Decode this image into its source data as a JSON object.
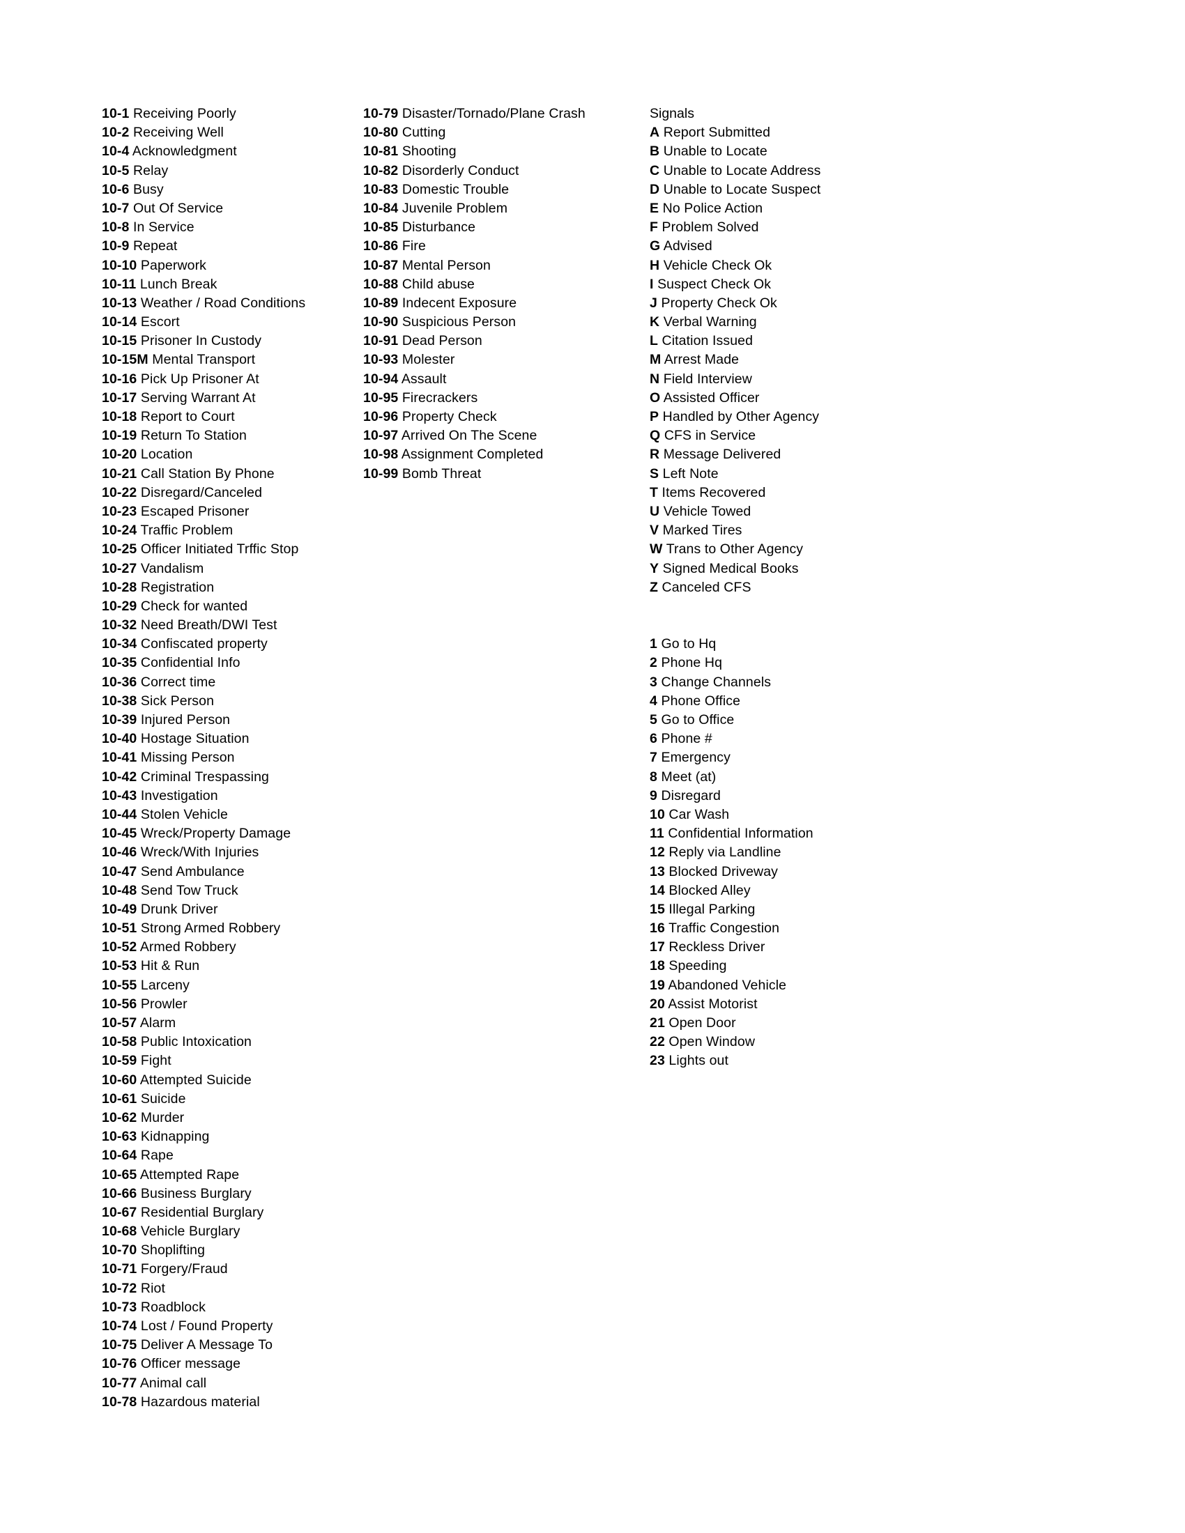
{
  "document": {
    "type": "police-ten-code-reference-sheet",
    "columns": {
      "codes_left": {
        "entries": [
          {
            "code": "10-1",
            "label": "Receiving Poorly"
          },
          {
            "code": "10-2",
            "label": "Receiving Well"
          },
          {
            "code": "10-4",
            "label": "Acknowledgment"
          },
          {
            "code": "10-5",
            "label": "Relay"
          },
          {
            "code": "10-6",
            "label": "Busy"
          },
          {
            "code": "10-7",
            "label": "Out Of Service"
          },
          {
            "code": "10-8",
            "label": "In Service"
          },
          {
            "code": "10-9",
            "label": "Repeat"
          },
          {
            "code": "10-10",
            "label": "Paperwork"
          },
          {
            "code": "10-11",
            "label": "Lunch Break"
          },
          {
            "code": "10-13",
            "label": "Weather / Road Conditions"
          },
          {
            "code": "10-14",
            "label": "Escort"
          },
          {
            "code": "10-15",
            "label": "Prisoner In Custody"
          },
          {
            "code": "10-15M",
            "label": " Mental Transport"
          },
          {
            "code": "10-16",
            "label": "Pick Up Prisoner At"
          },
          {
            "code": "10-17",
            "label": "Serving Warrant At"
          },
          {
            "code": "10-18",
            "label": "Report to Court"
          },
          {
            "code": "10-19",
            "label": "Return To Station"
          },
          {
            "code": "10-20",
            "label": "Location"
          },
          {
            "code": "10-21",
            "label": "Call Station By Phone"
          },
          {
            "code": "10-22",
            "label": "Disregard/Canceled"
          },
          {
            "code": "10-23",
            "label": "Escaped Prisoner"
          },
          {
            "code": "10-24",
            "label": "Traffic Problem"
          },
          {
            "code": "10-25",
            "label": "Officer Initiated Trffic Stop"
          },
          {
            "code": "10-27",
            "label": "Vandalism"
          },
          {
            "code": "10-28",
            "label": "Registration"
          },
          {
            "code": "10-29",
            "label": "Check for wanted"
          },
          {
            "code": "10-32",
            "label": "Need Breath/DWI Test"
          },
          {
            "code": "10-34",
            "label": "Confiscated property"
          },
          {
            "code": "10-35",
            "label": "Confidential Info"
          },
          {
            "code": "10-36",
            "label": "Correct time"
          },
          {
            "code": "10-38",
            "label": "Sick Person"
          },
          {
            "code": "10-39",
            "label": "Injured Person"
          },
          {
            "code": "10-40",
            "label": "Hostage Situation"
          },
          {
            "code": "10-41",
            "label": "Missing Person"
          },
          {
            "code": "10-42",
            "label": "Criminal Trespassing"
          },
          {
            "code": "10-43",
            "label": "Investigation"
          },
          {
            "code": "10-44",
            "label": "Stolen Vehicle"
          },
          {
            "code": "10-45",
            "label": "Wreck/Property Damage"
          },
          {
            "code": "10-46",
            "label": "Wreck/With Injuries"
          },
          {
            "code": "10-47",
            "label": "Send Ambulance"
          },
          {
            "code": "10-48",
            "label": "Send Tow Truck"
          },
          {
            "code": "10-49",
            "label": "Drunk Driver"
          },
          {
            "code": "10-51",
            "label": "Strong Armed Robbery"
          },
          {
            "code": "10-52",
            "label": "Armed Robbery"
          },
          {
            "code": "10-53",
            "label": "Hit & Run"
          },
          {
            "code": "10-55",
            "label": "Larceny"
          },
          {
            "code": "10-56",
            "label": "Prowler"
          },
          {
            "code": "10-57",
            "label": "Alarm"
          },
          {
            "code": "10-58",
            "label": "Public Intoxication"
          },
          {
            "code": "10-59",
            "label": "Fight"
          },
          {
            "code": "10-60",
            "label": "Attempted Suicide"
          },
          {
            "code": "10-61",
            "label": "Suicide"
          },
          {
            "code": "10-62",
            "label": "Murder"
          },
          {
            "code": "10-63",
            "label": "Kidnapping"
          },
          {
            "code": "10-64",
            "label": "Rape"
          },
          {
            "code": "10-65",
            "label": "Attempted Rape"
          },
          {
            "code": "10-66",
            "label": "Business Burglary"
          },
          {
            "code": "10-67",
            "label": "Residential Burglary"
          },
          {
            "code": "10-68",
            "label": "Vehicle Burglary"
          },
          {
            "code": "10-70",
            "label": "Shoplifting"
          },
          {
            "code": "10-71",
            "label": "Forgery/Fraud"
          },
          {
            "code": "10-72",
            "label": "Riot"
          },
          {
            "code": "10-73",
            "label": "Roadblock"
          },
          {
            "code": "10-74",
            "label": "Lost / Found Property"
          },
          {
            "code": "10-75",
            "label": "Deliver A Message To"
          },
          {
            "code": "10-76",
            "label": "Officer message"
          },
          {
            "code": "10-77",
            "label": "Animal call"
          },
          {
            "code": "10-78",
            "label": "Hazardous material"
          }
        ]
      },
      "codes_middle": {
        "entries": [
          {
            "code": "10-79",
            "label": "Disaster/Tornado/Plane Crash"
          },
          {
            "code": "10-80",
            "label": "Cutting"
          },
          {
            "code": "10-81",
            "label": "Shooting"
          },
          {
            "code": "10-82",
            "label": "Disorderly Conduct"
          },
          {
            "code": "10-83",
            "label": "Domestic Trouble"
          },
          {
            "code": "10-84",
            "label": "Juvenile Problem"
          },
          {
            "code": "10-85",
            "label": "Disturbance"
          },
          {
            "code": "10-86",
            "label": "Fire"
          },
          {
            "code": "10-87",
            "label": "Mental Person"
          },
          {
            "code": "10-88",
            "label": "Child abuse"
          },
          {
            "code": "10-89",
            "label": "Indecent Exposure"
          },
          {
            "code": "10-90",
            "label": "Suspicious Person"
          },
          {
            "code": "10-91",
            "label": "Dead Person"
          },
          {
            "code": "10-93",
            "label": "Molester"
          },
          {
            "code": "10-94",
            "label": "Assault"
          },
          {
            "code": "10-95",
            "label": "Firecrackers"
          },
          {
            "code": "10-96",
            "label": "Property Check"
          },
          {
            "code": "10-97",
            "label": "Arrived On The Scene"
          },
          {
            "code": "10-98",
            "label": "Assignment Completed"
          },
          {
            "code": "10-99",
            "label": "Bomb Threat"
          }
        ]
      },
      "signals": {
        "heading": "Signals",
        "letter_entries": [
          {
            "code": "A",
            "label": "Report Submitted"
          },
          {
            "code": "B",
            "label": "Unable to Locate"
          },
          {
            "code": "C",
            "label": "Unable to Locate Address"
          },
          {
            "code": "D",
            "label": "Unable to Locate Suspect"
          },
          {
            "code": "E",
            "label": "No Police Action"
          },
          {
            "code": "F",
            "label": "Problem Solved"
          },
          {
            "code": "G",
            "label": "Advised"
          },
          {
            "code": "H",
            "label": "Vehicle Check Ok"
          },
          {
            "code": "I",
            "label": "Suspect Check Ok"
          },
          {
            "code": "J",
            "label": "Property Check Ok"
          },
          {
            "code": "K",
            "label": "Verbal Warning"
          },
          {
            "code": "L",
            "label": "Citation Issued"
          },
          {
            "code": "M",
            "label": " Arrest Made"
          },
          {
            "code": "N",
            "label": "Field Interview"
          },
          {
            "code": "O",
            "label": "Assisted Officer"
          },
          {
            "code": "P",
            "label": "Handled by Other Agency"
          },
          {
            "code": "Q",
            "label": "CFS in Service"
          },
          {
            "code": "R",
            "label": "Message Delivered"
          },
          {
            "code": "S",
            "label": "Left Note"
          },
          {
            "code": "T",
            "label": "Items Recovered"
          },
          {
            "code": "U",
            "label": "Vehicle Towed"
          },
          {
            "code": "V",
            "label": "Marked Tires"
          },
          {
            "code": "W",
            "label": "Trans to Other Agency"
          },
          {
            "code": "Y",
            "label": "Signed Medical Books"
          },
          {
            "code": "Z",
            "label": "Canceled CFS"
          }
        ],
        "number_entries": [
          {
            "code": "1",
            "label": "Go to Hq"
          },
          {
            "code": "2",
            "label": "Phone Hq"
          },
          {
            "code": "3",
            "label": "Change Channels"
          },
          {
            "code": "4",
            "label": "Phone Office"
          },
          {
            "code": "5",
            "label": "Go to Office"
          },
          {
            "code": "6",
            "label": "Phone #"
          },
          {
            "code": "7",
            "label": "Emergency"
          },
          {
            "code": "8",
            "label": "Meet (at)"
          },
          {
            "code": "9",
            "label": "Disregard"
          },
          {
            "code": "10",
            "label": "Car Wash"
          },
          {
            "code": "11",
            "label": "Confidential Information"
          },
          {
            "code": "12",
            "label": "Reply via Landline"
          },
          {
            "code": "13",
            "label": "Blocked Driveway"
          },
          {
            "code": "14",
            "label": "Blocked Alley"
          },
          {
            "code": "15",
            "label": "Illegal Parking"
          },
          {
            "code": "16",
            "label": "Traffic Congestion"
          },
          {
            "code": "17",
            "label": "Reckless Driver"
          },
          {
            "code": "18",
            "label": "Speeding"
          },
          {
            "code": "19",
            "label": "Abandoned Vehicle"
          },
          {
            "code": "20",
            "label": "Assist Motorist"
          },
          {
            "code": "21",
            "label": "Open Door"
          },
          {
            "code": "22",
            "label": "Open Window"
          },
          {
            "code": "23",
            "label": "Lights out"
          }
        ]
      }
    }
  }
}
